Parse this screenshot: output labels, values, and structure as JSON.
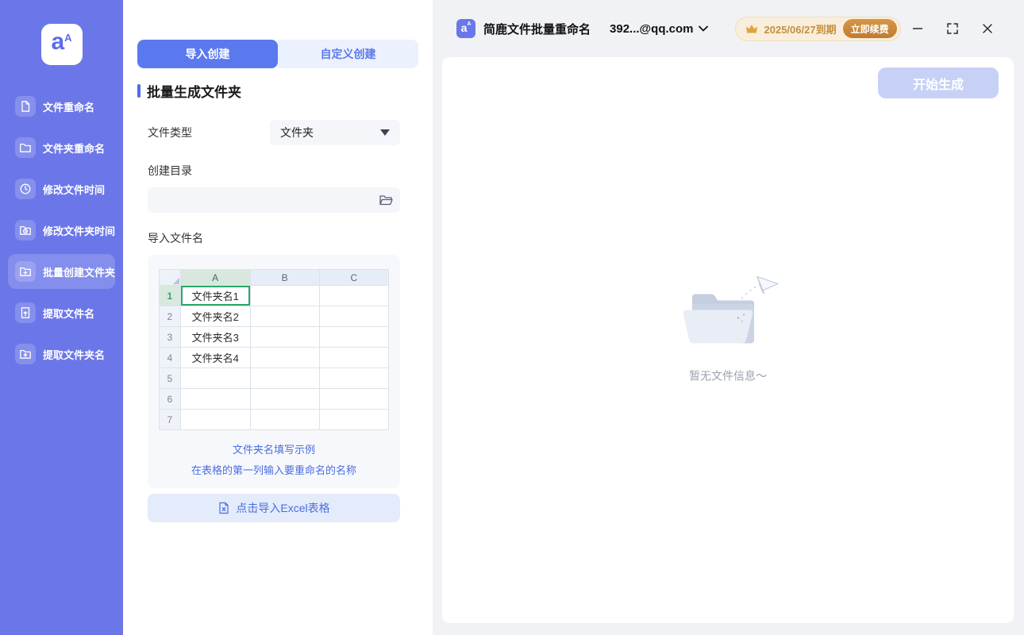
{
  "app": {
    "logo_text": "a",
    "logo_sup": "A"
  },
  "sidebar": {
    "items": [
      {
        "label": "文件重命名"
      },
      {
        "label": "文件夹重命名"
      },
      {
        "label": "修改文件时间"
      },
      {
        "label": "修改文件夹时间"
      },
      {
        "label": "批量创建文件夹"
      },
      {
        "label": "提取文件名"
      },
      {
        "label": "提取文件夹名"
      }
    ]
  },
  "panel": {
    "tabs": [
      {
        "label": "导入创建"
      },
      {
        "label": "自定义创建"
      }
    ],
    "section_title": "批量生成文件夹",
    "file_type_label": "文件类型",
    "file_type_value": "文件夹",
    "create_dir_label": "创建目录",
    "create_dir_value": "",
    "import_label": "导入文件名",
    "table": {
      "columns": [
        "A",
        "B",
        "C"
      ],
      "row_numbers": [
        "1",
        "2",
        "3",
        "4",
        "5",
        "6",
        "7"
      ],
      "rows": [
        [
          "文件夹名1",
          "",
          ""
        ],
        [
          "文件夹名2",
          "",
          ""
        ],
        [
          "文件夹名3",
          "",
          ""
        ],
        [
          "文件夹名4",
          "",
          ""
        ],
        [
          "",
          "",
          ""
        ],
        [
          "",
          "",
          ""
        ],
        [
          "",
          "",
          ""
        ]
      ]
    },
    "hint_link": "文件夹名填写示例",
    "hint_text": "在表格的第一列输入要重命名的名称",
    "import_button": "点击导入Excel表格"
  },
  "header": {
    "app_title": "简鹿文件批量重命名",
    "account": "392...@qq.com",
    "expiry": "2025/06/27到期",
    "renew_button": "立即续费"
  },
  "main": {
    "generate_button": "开始生成",
    "empty_text": "暂无文件信息～"
  },
  "colors": {
    "sidebar": "#6B77E8",
    "accent": "#5B79EF",
    "link": "#4A6EE0",
    "selection_green": "#2BA866",
    "expiry_text": "#C3903F",
    "renew_bg": "#C9813B"
  }
}
